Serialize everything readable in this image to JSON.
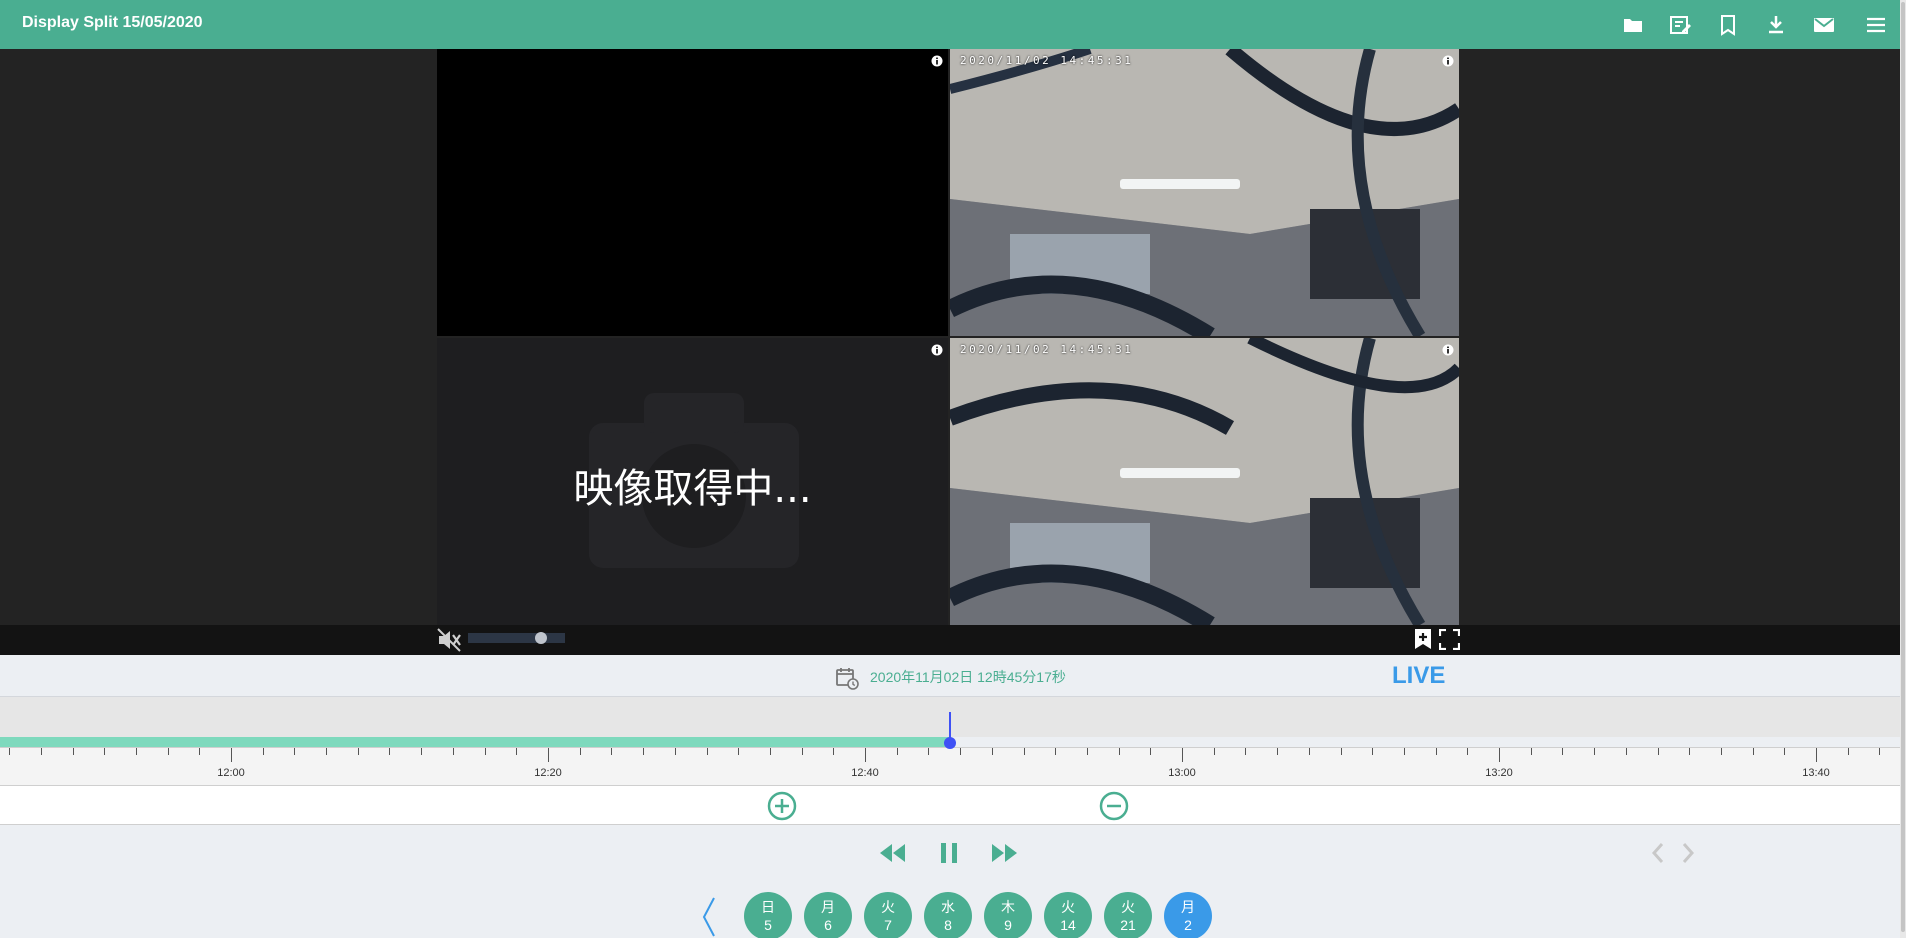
{
  "header": {
    "title": "Display Split 15/05/2020",
    "icons": [
      "folder-icon",
      "edit-note-icon",
      "bookmark-icon",
      "download-icon",
      "mail-icon",
      "menu-icon"
    ]
  },
  "video": {
    "cells": [
      {
        "state": "no-signal",
        "timestamp": ""
      },
      {
        "state": "camera",
        "timestamp": "2020/11/02 14:45:31"
      },
      {
        "state": "loading",
        "timestamp": "",
        "message": "映像取得中..."
      },
      {
        "state": "camera",
        "timestamp": "2020/11/02 14:45:31"
      }
    ],
    "muted": true,
    "volume": 0.75
  },
  "datebar": {
    "datetime": "2020年11月02日 12時45分17秒",
    "live_label": "LIVE"
  },
  "timeline": {
    "labels": [
      "12:00",
      "12:20",
      "12:40",
      "13:00",
      "13:20",
      "13:40"
    ],
    "recorded_until_fraction": 0.5
  },
  "colors": {
    "accent": "#4aae91",
    "live": "#3a9ae8",
    "playhead": "#3f51f5",
    "recorded": "#7ed9bd"
  },
  "days": [
    {
      "weekday": "日",
      "day": "5",
      "active": false
    },
    {
      "weekday": "月",
      "day": "6",
      "active": false
    },
    {
      "weekday": "火",
      "day": "7",
      "active": false
    },
    {
      "weekday": "水",
      "day": "8",
      "active": false
    },
    {
      "weekday": "木",
      "day": "9",
      "active": false
    },
    {
      "weekday": "火",
      "day": "14",
      "active": false
    },
    {
      "weekday": "火",
      "day": "21",
      "active": false
    },
    {
      "weekday": "月",
      "day": "2",
      "active": true
    }
  ]
}
